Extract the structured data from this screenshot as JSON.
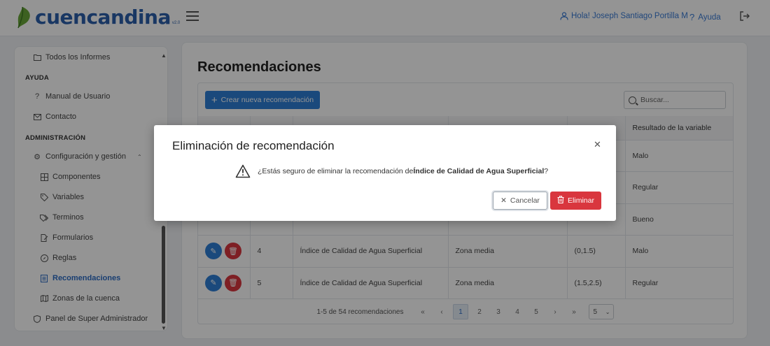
{
  "header": {
    "brand": "cuencandina",
    "version": "v2.0",
    "user_greeting": "Hola! Joseph Santiago Portilla M",
    "help_label": "Ayuda"
  },
  "sidebar": {
    "items": [
      {
        "label": "Todos los Informes",
        "icon": "folder-icon"
      },
      {
        "section": "AYUDA"
      },
      {
        "label": "Manual de Usuario",
        "icon": "question-icon"
      },
      {
        "label": "Contacto",
        "icon": "mail-icon"
      },
      {
        "section": "ADMINISTRACIÓN"
      },
      {
        "label": "Configuración y gestión",
        "icon": "gear-icon"
      },
      {
        "label": "Componentes",
        "icon": "grid-icon"
      },
      {
        "label": "Variables",
        "icon": "tag-icon"
      },
      {
        "label": "Terminos",
        "icon": "tags-icon"
      },
      {
        "label": "Formularios",
        "icon": "edit-icon"
      },
      {
        "label": "Reglas",
        "icon": "compass-icon"
      },
      {
        "label": "Recomendaciones",
        "icon": "list-icon",
        "active": true
      },
      {
        "label": "Zonas de la cuenca",
        "icon": "map-icon"
      },
      {
        "label": "Panel de Super Administrador",
        "icon": "shield-icon"
      }
    ]
  },
  "main": {
    "title": "Recomendaciones",
    "create_label": "Crear nueva recomendación",
    "search_placeholder": "Buscar...",
    "columns": [
      "",
      "",
      "",
      "",
      "",
      "Resultado de la variable"
    ],
    "rows": [
      {
        "id": "",
        "variable": "",
        "zona": "",
        "intervalo": "",
        "resultado": "Malo"
      },
      {
        "id": "",
        "variable": "",
        "zona": "",
        "intervalo": "",
        "resultado": "Regular"
      },
      {
        "id": "",
        "variable": "",
        "zona": "",
        "intervalo": "",
        "resultado": "Bueno"
      },
      {
        "id": "4",
        "variable": "Índice de Calidad de Agua Superficial",
        "zona": "Zona media",
        "intervalo": "(0,1.5)",
        "resultado": "Malo"
      },
      {
        "id": "5",
        "variable": "Índice de Calidad de Agua Superficial",
        "zona": "Zona media",
        "intervalo": "(1.5,2.5)",
        "resultado": "Regular"
      }
    ],
    "pagination": {
      "info": "1-5 de 54 recomendaciones",
      "first": "«",
      "prev": "‹",
      "pages": [
        "1",
        "2",
        "3",
        "4",
        "5"
      ],
      "active_page": "1",
      "next": "›",
      "last": "»",
      "page_size": "5"
    }
  },
  "modal": {
    "title": "Eliminación de recomendación",
    "message_prefix": "¿Estás seguro de eliminar la recomendación de ",
    "message_bold": "Índice de Calidad de Agua Superficial",
    "message_suffix": "?",
    "cancel_label": "Cancelar",
    "delete_label": "Eliminar"
  },
  "colors": {
    "brand": "#2b5fab",
    "primary": "#2e7fd6",
    "danger": "#d9363e",
    "leaf": "#6aa83a"
  }
}
